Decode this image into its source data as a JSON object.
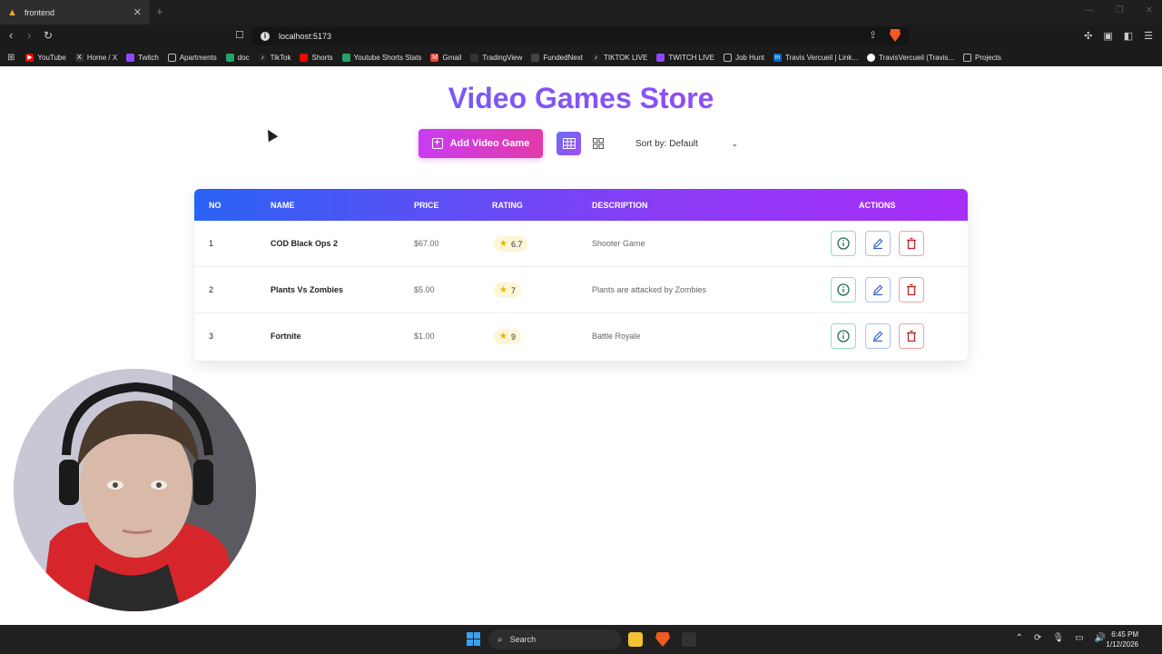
{
  "browser": {
    "tab_title": "frontend",
    "new_tab": "+",
    "url": "localhost:5173",
    "bookmarks": [
      {
        "label": "YouTube",
        "icon": "youtube-icon",
        "color": "#ff0000"
      },
      {
        "label": "Home / X",
        "icon": "x-icon",
        "color": "#333333"
      },
      {
        "label": "Twitch",
        "icon": "twitch-icon",
        "color": "#9146ff"
      },
      {
        "label": "Apartments",
        "icon": "folder-icon",
        "color": "#555555"
      },
      {
        "label": "doc",
        "icon": "sheets-icon",
        "color": "#21a464"
      },
      {
        "label": "TikTok",
        "icon": "tiktok-icon",
        "color": "#222222"
      },
      {
        "label": "Shorts",
        "icon": "shorts-icon",
        "color": "#ff0000"
      },
      {
        "label": "Youtube Shorts Stats",
        "icon": "sheets-icon",
        "color": "#21a464"
      },
      {
        "label": "Gmail",
        "icon": "gmail-icon",
        "color": "#ea4335"
      },
      {
        "label": "TradingView",
        "icon": "tradingview-icon",
        "color": "#333333"
      },
      {
        "label": "FundedNext",
        "icon": "fundednext-icon",
        "color": "#444444"
      },
      {
        "label": "TIKTOK LIVE",
        "icon": "tiktok-icon",
        "color": "#222222"
      },
      {
        "label": "TWITCH LIVE",
        "icon": "twitch-icon",
        "color": "#9146ff"
      },
      {
        "label": "Job Hunt",
        "icon": "folder-icon",
        "color": "#555555"
      },
      {
        "label": "Travis Vercueil | Link...",
        "icon": "linkedin-icon",
        "color": "#0a66c2"
      },
      {
        "label": "TravisVercueil (Travis...",
        "icon": "github-icon",
        "color": "#333333"
      },
      {
        "label": "Projects",
        "icon": "folder-icon",
        "color": "#555555"
      }
    ]
  },
  "app": {
    "title": "Video Games Store",
    "add_button": "Add Video Game",
    "sort_label": "Sort by: Default",
    "columns": {
      "no": "NO",
      "name": "NAME",
      "price": "PRICE",
      "rating": "RATING",
      "description": "DESCRIPTION",
      "actions": "ACTIONS"
    },
    "rows": [
      {
        "no": "1",
        "name": "COD Black Ops 2",
        "price": "$67.00",
        "rating": "6.7",
        "description": "Shooter Game"
      },
      {
        "no": "2",
        "name": "Plants Vs Zombies",
        "price": "$5.00",
        "rating": "7",
        "description": "Plants are attacked by Zombies"
      },
      {
        "no": "3",
        "name": "Fortnite",
        "price": "$1.00",
        "rating": "9",
        "description": "Battle Royale"
      }
    ],
    "colors": {
      "accent_gradient_start": "#2a63f5",
      "accent_gradient_end": "#a82ef7",
      "add_button": "#d13bd0",
      "info": "#2f9e6b",
      "edit": "#2f5fd0",
      "delete": "#c0262d",
      "rating_badge": "#fdf6d6"
    }
  },
  "taskbar": {
    "search_label": "Search",
    "time": "6:45 PM",
    "date": "1/12/2026"
  }
}
